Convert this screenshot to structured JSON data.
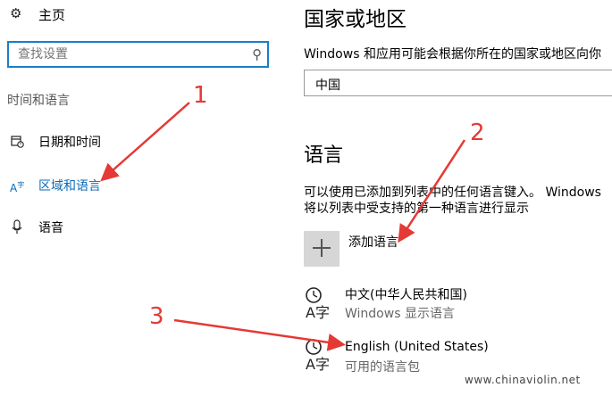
{
  "sidebar": {
    "home_label": "主页",
    "search_placeholder": "查找设置",
    "section_label": "时间和语言",
    "items": [
      {
        "label": "日期和时间",
        "icon": "calendar-clock-icon"
      },
      {
        "label": "区域和语言",
        "icon": "region-language-icon",
        "active": true
      },
      {
        "label": "语音",
        "icon": "microphone-icon"
      }
    ]
  },
  "region": {
    "title": "国家或地区",
    "description": "Windows 和应用可能会根据你所在的国家或地区向你",
    "selected_country": "中国"
  },
  "language": {
    "title": "语言",
    "description_line1": "可以使用已添加到列表中的任何语言键入。 Windows",
    "description_line2": "将以列表中受支持的第一种语言进行显示",
    "add_label": "添加语言",
    "items": [
      {
        "name": "中文(中华人民共和国)",
        "sub": "Windows 显示语言",
        "icon_glyph": "A字"
      },
      {
        "name": "English (United States)",
        "sub": "可用的语言包",
        "icon_glyph": "A字"
      }
    ]
  },
  "annotations": {
    "n1": "1",
    "n2": "2",
    "n3": "3",
    "color": "#e53935"
  },
  "watermark": "www.chinaviolin.net",
  "colors": {
    "accent": "#0b6ab7",
    "search_border": "#1a7fc8",
    "tile_bg": "#d6d6d6"
  }
}
